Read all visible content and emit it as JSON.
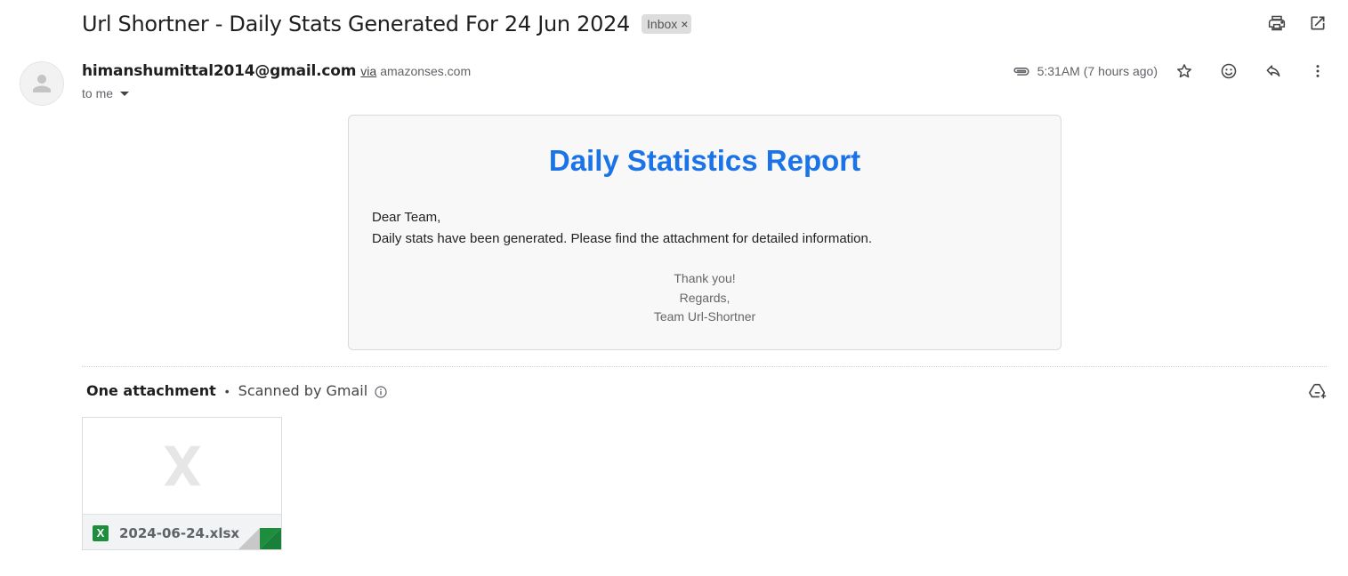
{
  "header": {
    "subject": "Url Shortner - Daily Stats Generated For 24 Jun 2024",
    "label": "Inbox",
    "label_remove": "×",
    "print_icon": "printer-icon",
    "popout_icon": "open-in-new-window-icon"
  },
  "sender": {
    "avatar_icon": "person-icon",
    "email": "himanshumittal2014@gmail.com",
    "via": "via",
    "via_domain": "amazonses.com",
    "to": "to me"
  },
  "meta": {
    "attachment_icon": "paperclip-icon",
    "timestamp": "5:31AM (7 hours ago)",
    "star_icon": "star-icon",
    "emoji_icon": "emoji-reaction-icon",
    "reply_icon": "reply-icon",
    "more_icon": "more-vert-icon"
  },
  "email_body": {
    "title": "Daily Statistics Report",
    "greeting": "Dear Team,",
    "message": "Daily stats have been generated. Please find the attachment for detailed information.",
    "closing_lines": [
      "Thank you!",
      "Regards,",
      "Team Url-Shortner"
    ],
    "title_color": "#1a73e8"
  },
  "attachments": {
    "count_label": "One attachment",
    "separator": "•",
    "scanned_label": "Scanned by Gmail",
    "info_icon": "info-icon",
    "add_to_drive_icon": "add-to-drive-icon",
    "files": [
      {
        "name": "2024-06-24.xlsx",
        "type_badge": "X",
        "preview_icon": "spreadsheet-x-icon",
        "accent_color": "#188038"
      }
    ]
  }
}
